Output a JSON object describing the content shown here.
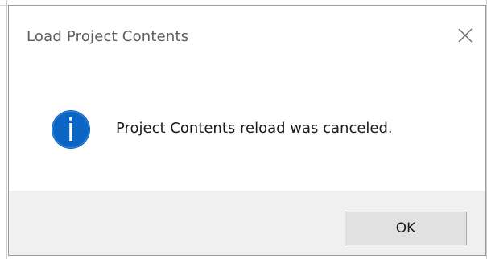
{
  "dialog": {
    "title": "Load Project Contents",
    "message": "Project Contents reload was canceled.",
    "icon": "info-icon",
    "close_icon": "close-icon",
    "ok_label": "OK"
  },
  "colors": {
    "title_text": "#5f5f5f",
    "info_icon_fill": "#0a65c4",
    "footer_background": "#f0f0f0",
    "button_background": "#e1e1e1",
    "button_border": "#adadad"
  }
}
